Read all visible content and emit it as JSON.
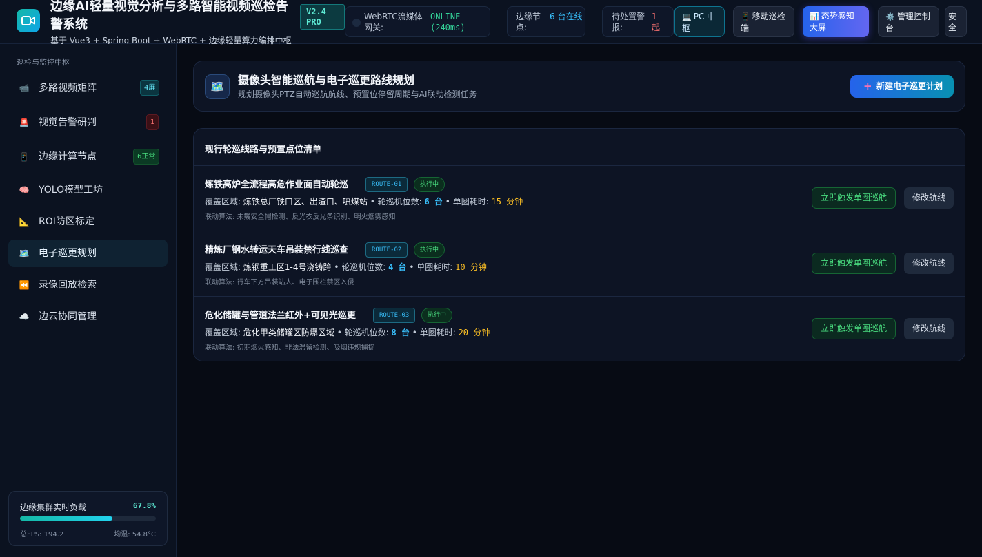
{
  "header": {
    "title": "边缘AI轻量视觉分析与多路智能视频巡检告警系统",
    "subtitle": "基于 Vue3 + Spring Boot + WebRTC + 边缘轻量算力编排中枢",
    "version": "V2.4 PRO",
    "gateway": {
      "label": "WebRTC流媒体网关:",
      "value": "ONLINE (240ms)",
      "color": "#34d399"
    },
    "edge_nodes": {
      "label": "边缘节点:",
      "value": "6 台在线",
      "color": "#38bdf8"
    },
    "pending": {
      "label": "待处置警报:",
      "value": "1 起",
      "color": "#f87171"
    },
    "buttons": [
      {
        "icon": "laptop-icon",
        "label": "PC 中枢"
      },
      {
        "icon": "phone-icon",
        "label": "移动巡检端"
      },
      {
        "icon": "chart-icon",
        "label": "态势感知大屏"
      },
      {
        "icon": "gear-icon",
        "label": "管理控制台"
      },
      {
        "icon": "",
        "label": "安全"
      }
    ]
  },
  "sidebar": {
    "section_title": "巡检与监控中枢",
    "items": [
      {
        "icon": "camera-icon",
        "label": "多路视频矩阵",
        "badge": "4屏",
        "badge_style": "teal"
      },
      {
        "icon": "siren-icon",
        "label": "视觉告警研判",
        "badge": "1",
        "badge_style": "red"
      },
      {
        "icon": "phone-icon",
        "label": "边缘计算节点",
        "badge": "6正常",
        "badge_style": "green"
      },
      {
        "icon": "brain-icon",
        "label": "YOLO模型工坊",
        "badge": "",
        "badge_style": ""
      },
      {
        "icon": "ruler-icon",
        "label": "ROI防区标定",
        "badge": "",
        "badge_style": ""
      },
      {
        "icon": "map-icon",
        "label": "电子巡更规划",
        "badge": "",
        "badge_style": "",
        "active": true
      },
      {
        "icon": "rewind-icon",
        "label": "录像回放检索",
        "badge": "",
        "badge_style": ""
      },
      {
        "icon": "cloud-icon",
        "label": "边云协同管理",
        "badge": "",
        "badge_style": ""
      }
    ],
    "load": {
      "title": "边缘集群实时负载",
      "percent_label": "67.8%",
      "percent": 67.8,
      "fps": "总FPS: 194.2",
      "temp": "均温: 54.8°C"
    }
  },
  "main": {
    "header": {
      "icon": "map-icon",
      "title": "摄像头智能巡航与电子巡更路线规划",
      "subtitle": "规划摄像头PTZ自动巡航航线、预置位停留周期与AI联动检测任务",
      "new_button": "新建电子巡更计划"
    },
    "list_title": "现行轮巡线路与预置点位清单",
    "routes": [
      {
        "name": "炼铁高炉全流程高危作业面自动轮巡",
        "code": "ROUTE-01",
        "status": "执行中",
        "area_label": "覆盖区域:",
        "area": "炼铁总厂铁口区、出渣口、喷煤站",
        "count_label": "轮巡机位数:",
        "count": "6 台",
        "time_label": "单圈耗时:",
        "time": "15 分钟",
        "algo": "联动算法: 未戴安全帽检测、反光衣反光条识别、明火烟雾感知",
        "trigger": "立即触发单圈巡航",
        "edit": "修改航线"
      },
      {
        "name": "精炼厂钢水转运天车吊装禁行线巡查",
        "code": "ROUTE-02",
        "status": "执行中",
        "area_label": "覆盖区域:",
        "area": "炼钢重工区1-4号浇铸跨",
        "count_label": "轮巡机位数:",
        "count": "4 台",
        "time_label": "单圈耗时:",
        "time": "10 分钟",
        "algo": "联动算法: 行车下方吊装站人、电子围栏禁区入侵",
        "trigger": "立即触发单圈巡航",
        "edit": "修改航线"
      },
      {
        "name": "危化储罐与管道法兰红外+可见光巡更",
        "code": "ROUTE-03",
        "status": "执行中",
        "area_label": "覆盖区域:",
        "area": "危化甲类储罐区防爆区域",
        "count_label": "轮巡机位数:",
        "count": "8 台",
        "time_label": "单圈耗时:",
        "time": "20 分钟",
        "algo": "联动算法: 初期烟火感知、非法滞留检测、吸烟违规捕捉",
        "trigger": "立即触发单圈巡航",
        "edit": "修改航线"
      }
    ]
  }
}
